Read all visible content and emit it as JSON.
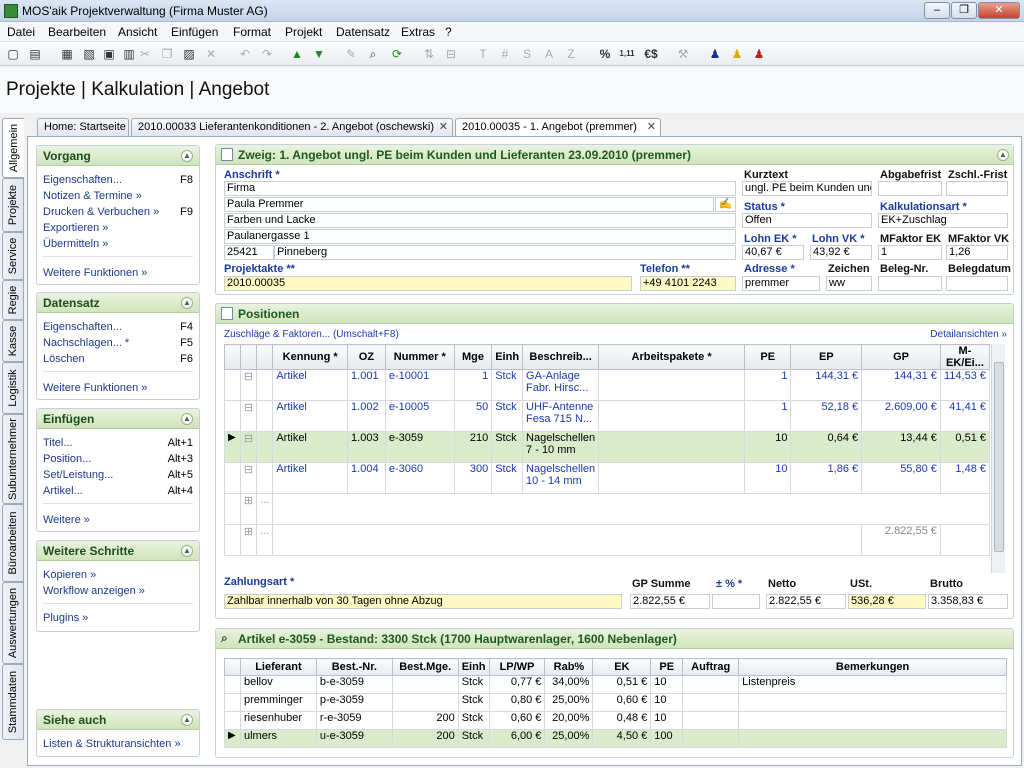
{
  "window": {
    "title": "MOS'aik Projektverwaltung (Firma Muster AG)",
    "min": "–",
    "max": "❐",
    "close": "✕"
  },
  "menu": [
    "Datei",
    "Bearbeiten",
    "Ansicht",
    "Einfügen",
    "Format",
    "Projekt",
    "Datensatz",
    "Extras",
    "?"
  ],
  "toolbar_glyphs": {
    "t1": "T",
    "t2": "#",
    "t3": "S",
    "t4": "A",
    "t5": "Z",
    "pct": "%",
    "dec": "1,11",
    "cur": "€$"
  },
  "header": {
    "title": "Projekte | Kalkulation | Angebot"
  },
  "vtabs": [
    "Allgemein",
    "Projekte",
    "Service",
    "Regie",
    "Kasse",
    "Logistik",
    "Subunternehmer",
    "Büroarbeiten",
    "Auswertungen",
    "Stammdaten"
  ],
  "tabs": [
    {
      "label": "Home: Startseite"
    },
    {
      "label": "2010.00033 Lieferantenkonditionen - 2. Angebot (oschewski)",
      "close": "✕"
    },
    {
      "label": "2010.00035 - 1. Angebot (premmer)",
      "close": "✕"
    }
  ],
  "left": {
    "vorgang": {
      "title": "Vorgang",
      "items": [
        {
          "label": "Eigenschaften...",
          "key": "F8"
        },
        {
          "label": "Notizen & Termine »",
          "key": ""
        },
        {
          "label": "Drucken & Verbuchen »",
          "key": "F9"
        },
        {
          "label": "Exportieren »",
          "key": ""
        },
        {
          "label": "Übermitteln »",
          "key": ""
        }
      ],
      "more": "Weitere Funktionen »"
    },
    "datensatz": {
      "title": "Datensatz",
      "items": [
        {
          "label": "Eigenschaften...",
          "key": "F4"
        },
        {
          "label": "Nachschlagen... *",
          "key": "F5"
        },
        {
          "label": "Löschen",
          "key": "F6"
        }
      ],
      "more": "Weitere Funktionen »"
    },
    "einfuegen": {
      "title": "Einfügen",
      "items": [
        {
          "label": "Titel...",
          "key": "Alt+1"
        },
        {
          "label": "Position...",
          "key": "Alt+3"
        },
        {
          "label": "Set/Leistung...",
          "key": "Alt+5"
        },
        {
          "label": "Artikel...",
          "key": "Alt+4"
        }
      ],
      "more": "Weitere »"
    },
    "schritte": {
      "title": "Weitere Schritte",
      "items": [
        {
          "label": "Kopieren »"
        },
        {
          "label": "Workflow anzeigen »"
        }
      ],
      "more": "Plugins »"
    },
    "siehe": {
      "title": "Siehe auch",
      "items": [
        {
          "label": "Listen & Strukturansichten »"
        }
      ]
    }
  },
  "zweig": {
    "title": "Zweig: 1. Angebot ungl. PE beim Kunden und Lieferanten 23.09.2010 (premmer)",
    "anschrift_label": "Anschrift *",
    "anschrift": [
      "Firma",
      "Paula Premmer",
      "Farben und Lacke",
      "Paulanergasse 1"
    ],
    "plz": "25421",
    "ort": "Pinneberg",
    "projektakte_label": "Projektakte **",
    "projektakte": "2010.00035",
    "telefon_label": "Telefon **",
    "telefon": "+49 4101 2243",
    "kurztext_label": "Kurztext",
    "kurztext": "ungl. PE beim Kunden und",
    "abgabefrist_label": "Abgabefrist",
    "zschl_label": "Zschl.-Frist",
    "status_label": "Status *",
    "status": "Offen",
    "kalkart_label": "Kalkulationsart *",
    "kalkart": "EK+Zuschlag",
    "lohnek_label": "Lohn EK *",
    "lohnek": "40,67 €",
    "lohnvk_label": "Lohn VK *",
    "lohnvk": "43,92 €",
    "mfek_label": "MFaktor EK",
    "mfek": "1",
    "mfvk_label": "MFaktor VK",
    "mfvk": "1,26",
    "adresse_label": "Adresse *",
    "adresse": "premmer",
    "zeichen_label": "Zeichen",
    "zeichen": "ww",
    "belegnr_label": "Beleg-Nr.",
    "belegdatum_label": "Belegdatum"
  },
  "positionen": {
    "title": "Positionen",
    "zuschlaege": "Zuschläge & Faktoren... (Umschalt+F8)",
    "detail": "Detailansichten »",
    "columns": [
      "Kennung *",
      "OZ",
      "Nummer *",
      "Mge",
      "Einh",
      "Beschreib...",
      "Arbeitspakete *",
      "PE",
      "EP",
      "GP",
      "M-EK/Ei..."
    ],
    "rows": [
      {
        "kennung": "Artikel",
        "oz": "1.001",
        "nummer": "e-10001",
        "mge": "1",
        "einh": "Stck",
        "beschr1": "GA-Anlage",
        "beschr2": "Fabr. Hirsc...",
        "pe": "1",
        "ep": "144,31 €",
        "gp": "144,31 €",
        "mek": "114,53 €",
        "blue": true
      },
      {
        "kennung": "Artikel",
        "oz": "1.002",
        "nummer": "e-10005",
        "mge": "50",
        "einh": "Stck",
        "beschr1": "UHF-Antenne",
        "beschr2": "Fesa 715 N...",
        "pe": "1",
        "ep": "52,18 €",
        "gp": "2.609,00 €",
        "mek": "41,41 €",
        "blue": true
      },
      {
        "kennung": "Artikel",
        "oz": "1.003",
        "nummer": "e-3059",
        "mge": "210",
        "einh": "Stck",
        "beschr1": "Nagelschellen",
        "beschr2": "7 - 10 mm",
        "pe": "10",
        "ep": "0,64 €",
        "gp": "13,44 €",
        "mek": "0,51 €",
        "blue": false
      },
      {
        "kennung": "Artikel",
        "oz": "1.004",
        "nummer": "e-3060",
        "mge": "300",
        "einh": "Stck",
        "beschr1": "Nagelschellen",
        "beschr2": "10 - 14 mm",
        "pe": "10",
        "ep": "1,86 €",
        "gp": "55,80 €",
        "mek": "1,48 €",
        "blue": true
      }
    ],
    "ellipsis": "...",
    "total": "2.822,55 €"
  },
  "summen": {
    "zahlungsart_label": "Zahlungsart *",
    "zahlungsart": "Zahlbar innerhalb von 30 Tagen ohne Abzug",
    "gp_label": "GP Summe",
    "gp": "2.822,55 €",
    "pct_label": "± % *",
    "pct": "",
    "netto_label": "Netto",
    "netto": "2.822,55 €",
    "ust_label": "USt.",
    "ust": "536,28 €",
    "brutto_label": "Brutto",
    "brutto": "3.358,83 €"
  },
  "artikel": {
    "title": "Artikel e-3059 - Bestand: 3300 Stck (1700 Hauptwarenlager, 1600 Nebenlager)",
    "columns": [
      "Lieferant",
      "Best.-Nr.",
      "Best.Mge.",
      "Einh",
      "LP/WP",
      "Rab%",
      "EK",
      "PE",
      "Auftrag",
      "Bemerkungen"
    ],
    "rows": [
      {
        "lief": "bellov",
        "nr": "b-e-3059",
        "mge": "",
        "einh": "Stck",
        "lp": "0,77 €",
        "rab": "34,00%",
        "ek": "0,51 €",
        "pe": "10",
        "auftrag": "",
        "bem": "Listenpreis"
      },
      {
        "lief": "premminger",
        "nr": "p-e-3059",
        "mge": "",
        "einh": "Stck",
        "lp": "0,80 €",
        "rab": "25,00%",
        "ek": "0,60 €",
        "pe": "10",
        "auftrag": "",
        "bem": ""
      },
      {
        "lief": "riesenhuber",
        "nr": "r-e-3059",
        "mge": "200",
        "einh": "Stck",
        "lp": "0,60 €",
        "rab": "20,00%",
        "ek": "0,48 €",
        "pe": "10",
        "auftrag": "",
        "bem": ""
      },
      {
        "lief": "ulmers",
        "nr": "u-e-3059",
        "mge": "200",
        "einh": "Stck",
        "lp": "6,00 €",
        "rab": "25,00%",
        "ek": "4,50 €",
        "pe": "100",
        "auftrag": "",
        "bem": ""
      }
    ]
  }
}
